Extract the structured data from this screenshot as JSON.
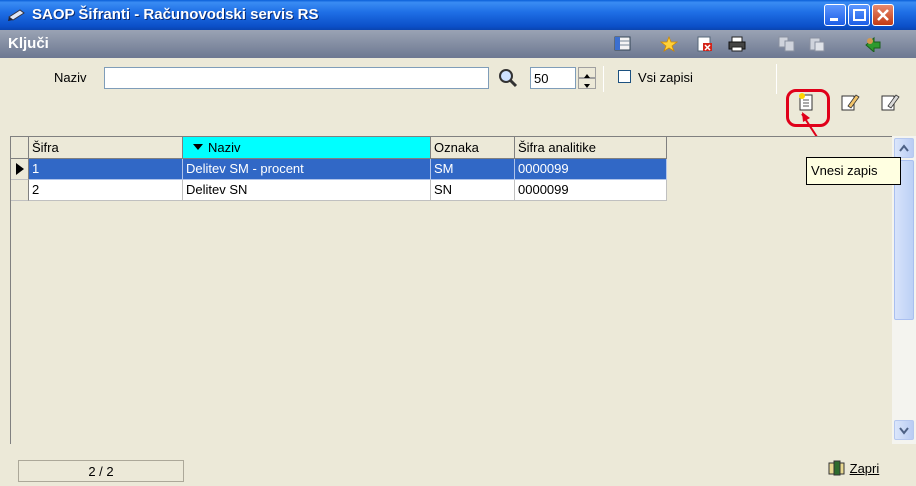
{
  "window": {
    "title": "SAOP Šifranti - Računovodski servis RS"
  },
  "panel": {
    "title": "Ključi"
  },
  "toolbar": {
    "search_label": "Naziv",
    "search_value": "",
    "limit_value": "50",
    "all_records_label": "Vsi zapisi",
    "all_records_checked": false
  },
  "tooltip": {
    "text": "Vnesi zapis"
  },
  "table": {
    "columns": [
      "Šifra",
      "Naziv",
      "Oznaka",
      "Šifra analitike"
    ],
    "sorted_column": "Naziv",
    "rows": [
      {
        "sifra": "1",
        "naziv": "Delitev SM - procent",
        "oznaka": "SM",
        "sifra_analitike": "0000099",
        "selected": true
      },
      {
        "sifra": "2",
        "naziv": "Delitev SN",
        "oznaka": "SN",
        "sifra_analitike": "0000099",
        "selected": false
      }
    ]
  },
  "status": {
    "record_count": "2 / 2",
    "close_label": "Zapri"
  },
  "colors": {
    "title_bar": "#0b4fc8",
    "selection": "#3168c6",
    "sorted_header": "#00ffff",
    "highlight": "#e0001a"
  }
}
